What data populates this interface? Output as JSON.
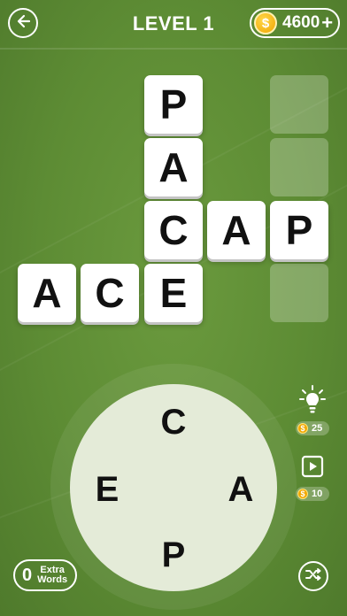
{
  "header": {
    "level_label": "LEVEL 1",
    "coins": "4600",
    "coin_symbol": "$",
    "add_symbol": "+"
  },
  "grid": {
    "letters": {
      "p_top": "P",
      "a_mid": "A",
      "c_cross": "C",
      "a_right": "A",
      "p_right": "P",
      "a_left": "A",
      "c_left": "C",
      "e_bottom": "E"
    },
    "found_words": [
      "PACE",
      "CAP",
      "ACE"
    ],
    "hidden_word_length": 4
  },
  "wheel": {
    "letters": [
      "C",
      "A",
      "P",
      "E"
    ]
  },
  "hint": {
    "cost": "25",
    "coin_symbol": "$"
  },
  "video": {
    "reward": "10",
    "coin_symbol": "$"
  },
  "extra_words": {
    "count": "0",
    "line1": "Extra",
    "line2": "Words"
  },
  "colors": {
    "background": "#5d8c34",
    "tile": "#ffffff",
    "empty_tile": "rgba(255,255,255,0.25)",
    "coin": "#f0a400",
    "wheel": "#e4ebd8"
  }
}
